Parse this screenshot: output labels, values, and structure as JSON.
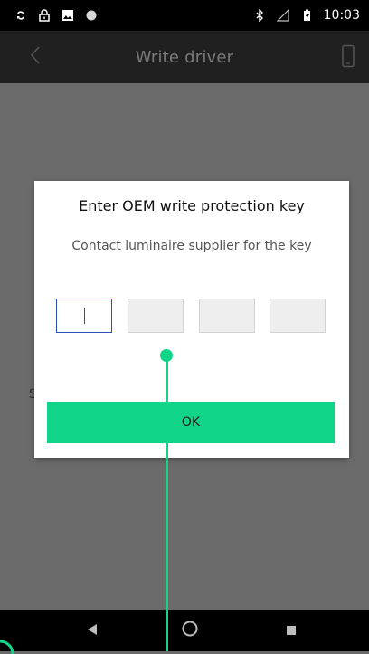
{
  "status_bar": {
    "time": "10:03",
    "left_icons": [
      "sync-icon",
      "lock-icon",
      "image-icon",
      "dot-icon"
    ],
    "right_icons": [
      "bluetooth-icon",
      "signal-icon",
      "battery-icon"
    ]
  },
  "app_bar": {
    "title": "Write driver",
    "back_icon": "chevron-left-icon",
    "right_icon": "phone-icon"
  },
  "background": {
    "partial_text": "S"
  },
  "dialog": {
    "title": "Enter OEM write protection key",
    "subtitle": "Contact luminaire supplier for the key",
    "key_fields": [
      "",
      "",
      "",
      ""
    ],
    "ok_label": "OK"
  },
  "nav_bar": {
    "buttons": [
      "back-triangle-icon",
      "home-circle-icon",
      "recents-square-icon"
    ]
  },
  "colors": {
    "accent": "#10d588",
    "focus": "#2a4fb8",
    "overlay": "#6b6b6b",
    "appbar": "#202020"
  }
}
